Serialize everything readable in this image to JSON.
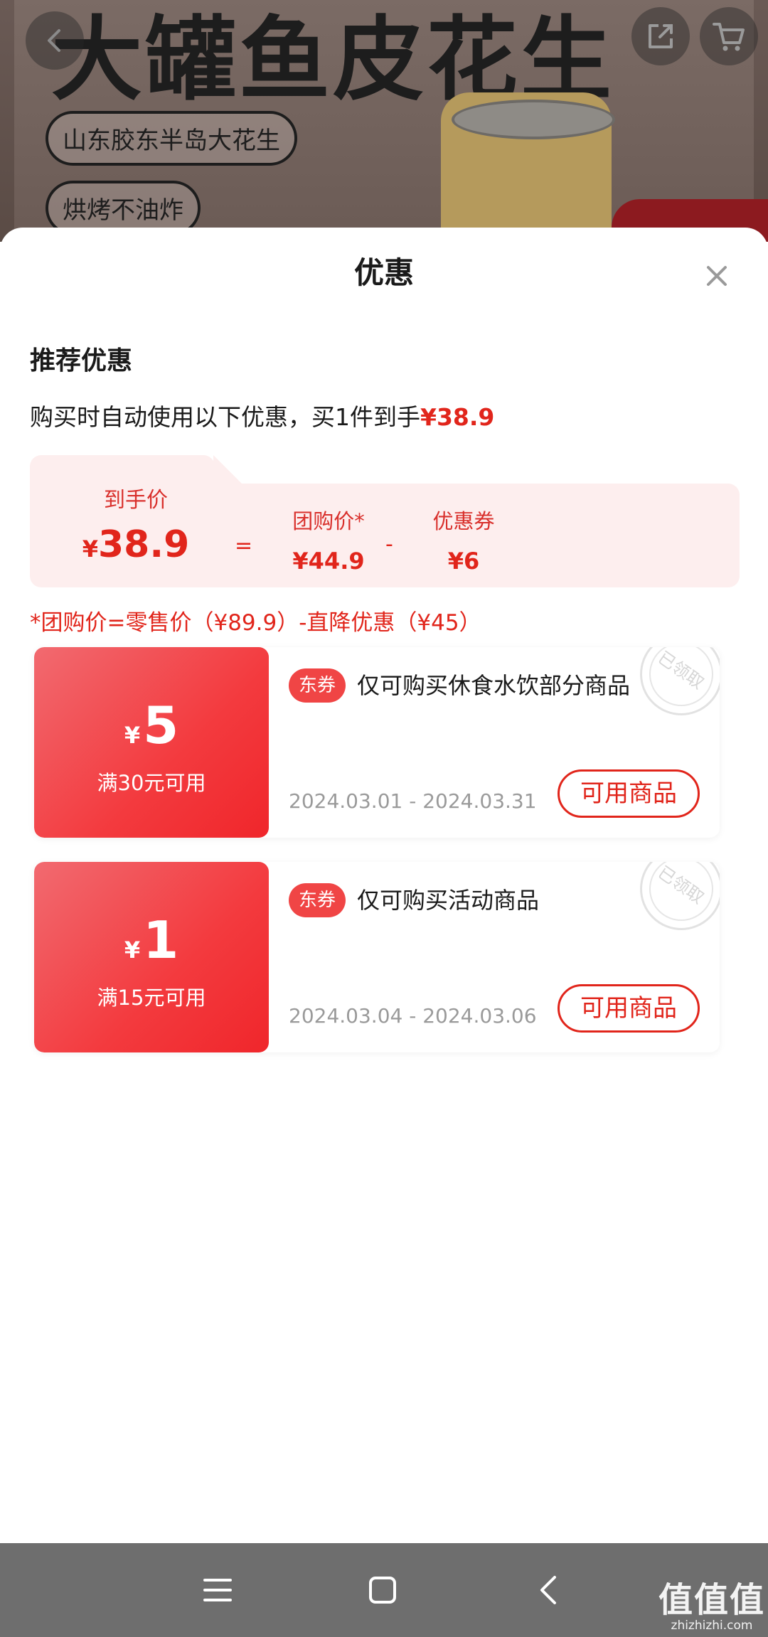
{
  "banner": {
    "title": "大罐鱼皮花生",
    "tag1": "山东胶东半岛大花生",
    "tag2": "烘烤不油炸"
  },
  "sheet": {
    "title": "优惠",
    "close_glyph": "✕",
    "section_title": "推荐优惠",
    "auto_line_prefix": "购买时自动使用以下优惠，买1件到手",
    "auto_line_price": "¥38.9",
    "breakdown": {
      "final_label": "到手价",
      "final_yen": "¥",
      "final_value": "38.9",
      "eq": "=",
      "group_label": "团购价*",
      "group_value": "¥44.9",
      "minus": "-",
      "coupon_label": "优惠券",
      "coupon_value": "¥6"
    },
    "note": "*团购价=零售价（¥89.9）-直降优惠（¥45）"
  },
  "coupons": [
    {
      "yen": "¥",
      "amount": "5",
      "condition": "满30元可用",
      "badge": "东券",
      "description": "仅可购买休食水饮部分商品",
      "date_range": "2024.03.01 - 2024.03.31",
      "button": "可用商品",
      "stamp": "已领取"
    },
    {
      "yen": "¥",
      "amount": "1",
      "condition": "满15元可用",
      "badge": "东券",
      "description": "仅可购买活动商品",
      "date_range": "2024.03.04 - 2024.03.06",
      "button": "可用商品",
      "stamp": "已领取"
    }
  ],
  "watermark": {
    "big": "值值值",
    "small": "zhizhizhi.com"
  },
  "colors": {
    "accent_red": "#e1251b",
    "coupon_gradient_start": "#f26a70",
    "coupon_gradient_end": "#f0262b",
    "breakdown_bg": "#fdeeee",
    "navbar_bg": "#6e6e6e"
  }
}
